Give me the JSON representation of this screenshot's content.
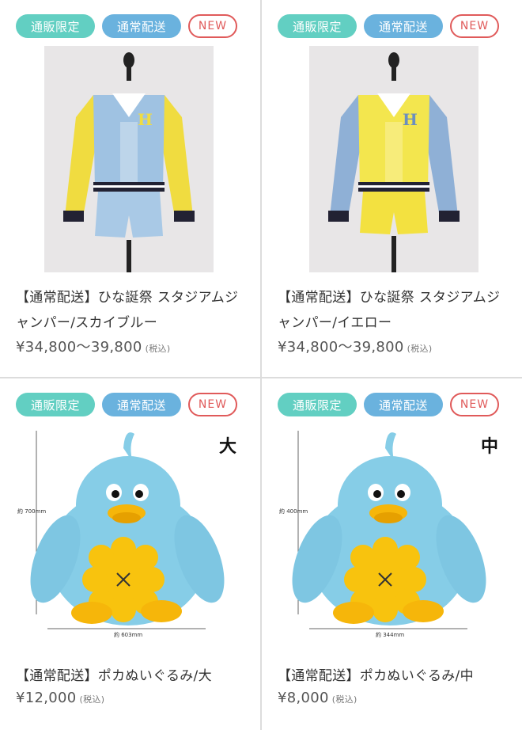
{
  "badges": {
    "limited": "通販限定",
    "standard": "通常配送",
    "new": "NEW"
  },
  "products": [
    {
      "title": "【通常配送】ひな誕祭 スタジアムジャンパー/スカイブルー",
      "price": "¥34,800〜39,800",
      "tax": "(税込)"
    },
    {
      "title": "【通常配送】ひな誕祭 スタジアムジャンパー/イエロー",
      "price": "¥34,800〜39,800",
      "tax": "(税込)"
    },
    {
      "title": "【通常配送】ポカぬいぐるみ/大",
      "price": "¥12,000",
      "tax": "(税込)",
      "size_mark": "大",
      "height_label": "約 700mm",
      "width_label": "約 603mm"
    },
    {
      "title": "【通常配送】ポカぬいぐるみ/中",
      "price": "¥8,000",
      "tax": "(税込)",
      "size_mark": "中",
      "height_label": "約 400mm",
      "width_label": "約 344mm"
    }
  ],
  "colors": {
    "limited": "#62cfc2",
    "standard": "#6ab2de",
    "new": "#e05a5a",
    "sky": "#9fc2e2",
    "yellow": "#f3e64e",
    "plush_blue": "#86cde7",
    "plush_orange": "#f8c30e"
  },
  "icons": {
    "mannequin": "jacket-on-mannequin",
    "plush": "poka-bird-plush"
  }
}
